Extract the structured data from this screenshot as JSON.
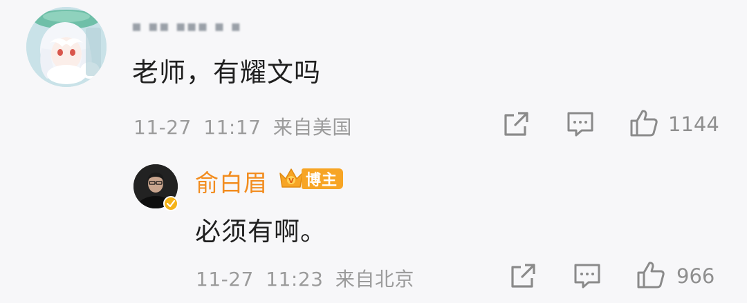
{
  "comment": {
    "username_masked": "▪ ▪▪ ▪▪▪ ▪ ▪",
    "text": "老师，有耀文吗",
    "date": "11-27",
    "time": "11:17",
    "location": "来自美国",
    "likes": "1144",
    "avatar_icon": "anime-avatar-icon"
  },
  "reply": {
    "username": "俞白眉",
    "badge_label": "博主",
    "text": "必须有啊。",
    "date": "11-27",
    "time": "11:23",
    "location": "来自北京",
    "likes": "966",
    "avatar_icon": "user-photo-avatar",
    "verified_color": "#f5b318"
  },
  "colors": {
    "accent_name": "#f28c1e",
    "badge_bg": "#f7a525",
    "meta_text": "#9b9b9b",
    "background": "#f7f7f9"
  },
  "actions": [
    "share-icon",
    "comment-icon",
    "like-icon"
  ]
}
